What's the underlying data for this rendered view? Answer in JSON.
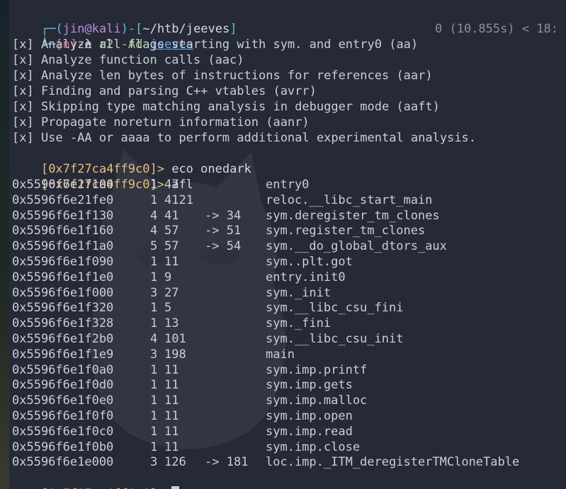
{
  "prompt": {
    "corner_top": "┌─",
    "corner_bottom": "└─",
    "open_paren": "(",
    "user": "jin",
    "at": "@",
    "host": "kali",
    "close_paren": ")",
    "dash": "-",
    "path_open": "[",
    "path": "~/htb/jeeves",
    "path_close": "]",
    "mode": "[n]",
    "lambda": "-λ",
    "command": "r2 -Ad",
    "arg": "jeeves",
    "status": "0 (10.855s) < 18:"
  },
  "analysis": [
    "[x] Analyze all flags starting with sym. and entry0 (aa)",
    "[x] Analyze function calls (aac)",
    "[x] Analyze len bytes of instructions for references (aar)",
    "[x] Finding and parsing C++ vtables (avrr)",
    "[x] Skipping type matching analysis in debugger mode (aaft)",
    "[x] Propagate noreturn information (aanr)",
    "[x] Use -AA or aaaa to perform additional experimental analysis."
  ],
  "r2": {
    "addr_prompt": "[0x7f27ca4ff9c0]>",
    "cmd1": "eco onedark",
    "cmd2": "afl"
  },
  "functions": [
    {
      "addr": "0x5596f6e1f100",
      "bbs": "1",
      "size": "47",
      "xref": "",
      "name": "entry0"
    },
    {
      "addr": "0x5596f6e21fe0",
      "bbs": "1",
      "size": "4121",
      "xref": "",
      "name": "reloc.__libc_start_main"
    },
    {
      "addr": "0x5596f6e1f130",
      "bbs": "4",
      "size": "41",
      "xref": "-> 34",
      "name": "sym.deregister_tm_clones"
    },
    {
      "addr": "0x5596f6e1f160",
      "bbs": "4",
      "size": "57",
      "xref": "-> 51",
      "name": "sym.register_tm_clones"
    },
    {
      "addr": "0x5596f6e1f1a0",
      "bbs": "5",
      "size": "57",
      "xref": "-> 54",
      "name": "sym.__do_global_dtors_aux"
    },
    {
      "addr": "0x5596f6e1f090",
      "bbs": "1",
      "size": "11",
      "xref": "",
      "name": "sym..plt.got"
    },
    {
      "addr": "0x5596f6e1f1e0",
      "bbs": "1",
      "size": "9",
      "xref": "",
      "name": "entry.init0"
    },
    {
      "addr": "0x5596f6e1f000",
      "bbs": "3",
      "size": "27",
      "xref": "",
      "name": "sym._init"
    },
    {
      "addr": "0x5596f6e1f320",
      "bbs": "1",
      "size": "5",
      "xref": "",
      "name": "sym.__libc_csu_fini"
    },
    {
      "addr": "0x5596f6e1f328",
      "bbs": "1",
      "size": "13",
      "xref": "",
      "name": "sym._fini"
    },
    {
      "addr": "0x5596f6e1f2b0",
      "bbs": "4",
      "size": "101",
      "xref": "",
      "name": "sym.__libc_csu_init"
    },
    {
      "addr": "0x5596f6e1f1e9",
      "bbs": "3",
      "size": "198",
      "xref": "",
      "name": "main"
    },
    {
      "addr": "0x5596f6e1f0a0",
      "bbs": "1",
      "size": "11",
      "xref": "",
      "name": "sym.imp.printf"
    },
    {
      "addr": "0x5596f6e1f0d0",
      "bbs": "1",
      "size": "11",
      "xref": "",
      "name": "sym.imp.gets"
    },
    {
      "addr": "0x5596f6e1f0e0",
      "bbs": "1",
      "size": "11",
      "xref": "",
      "name": "sym.imp.malloc"
    },
    {
      "addr": "0x5596f6e1f0f0",
      "bbs": "1",
      "size": "11",
      "xref": "",
      "name": "sym.imp.open"
    },
    {
      "addr": "0x5596f6e1f0c0",
      "bbs": "1",
      "size": "11",
      "xref": "",
      "name": "sym.imp.read"
    },
    {
      "addr": "0x5596f6e1f0b0",
      "bbs": "1",
      "size": "11",
      "xref": "",
      "name": "sym.imp.close"
    },
    {
      "addr": "0x5596f6e1e000",
      "bbs": "3",
      "size": "126",
      "xref": "-> 181",
      "name": "loc.imp._ITM_deregisterTMCloneTable"
    }
  ],
  "colors": {
    "background": "#262a36",
    "prompt_accent": "#59c2d6",
    "address_prompt": "#e5c07b",
    "text": "#c9ced8"
  }
}
